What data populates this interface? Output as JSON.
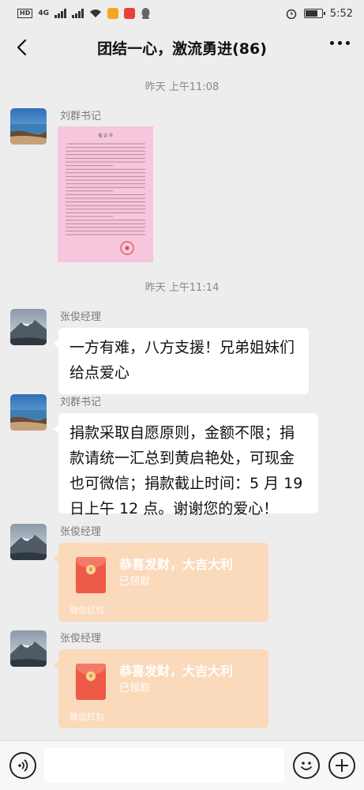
{
  "status_bar": {
    "network_badge": "HD",
    "network_type": "4G",
    "time": "5:52",
    "icons": [
      "hd-icon",
      "signal-icon",
      "signal-icon",
      "wifi-icon",
      "video-app-icon",
      "weibo-app-icon",
      "qq-icon",
      "alarm-icon",
      "battery-icon"
    ],
    "battery_level": 0.75
  },
  "header": {
    "title": "团结一心，激流勇进(86)",
    "back_icon": "chevron-left-icon",
    "more_icon": "more-dots-icon"
  },
  "messages": [
    {
      "type": "timestamp",
      "text": "昨天 上午11:08"
    },
    {
      "type": "image",
      "sender": "刘群书记",
      "avatar": "lake-landscape",
      "doc": {
        "title": "倡 议 书"
      }
    },
    {
      "type": "timestamp",
      "text": "昨天 上午11:14"
    },
    {
      "type": "text",
      "sender": "张俊经理",
      "avatar": "mountain-landscape",
      "lines": [
        "一方有难，八方支援！兄弟姐妹们",
        "给点爱心"
      ]
    },
    {
      "type": "text",
      "sender": "刘群书记",
      "avatar": "lake-landscape",
      "lines": [
        "捐款采取自愿原则，金额不限；捐",
        "款请统一汇总到黄启艳处，可现金",
        "也可微信；捐款截止时间：5 月 19",
        "日上午 12 点。谢谢您的爱心！"
      ]
    },
    {
      "type": "red_packet",
      "sender": "张俊经理",
      "avatar": "mountain-landscape",
      "title": "恭喜发财，大吉大利",
      "status": "已领取",
      "footer": "微信红包"
    },
    {
      "type": "red_packet",
      "sender": "张俊经理",
      "avatar": "mountain-landscape",
      "title": "恭喜发财，大吉大利",
      "status": "已领取",
      "footer": "微信红包"
    }
  ],
  "input_bar": {
    "placeholder": "",
    "voice_icon": "voice-icon",
    "emoji_icon": "emoji-icon",
    "plus_icon": "plus-icon"
  },
  "colors": {
    "background": "#ededed",
    "bubble": "#ffffff",
    "red_packet": "#fbd9bb",
    "envelope": "#ee5a48",
    "timestamp": "#888888"
  }
}
